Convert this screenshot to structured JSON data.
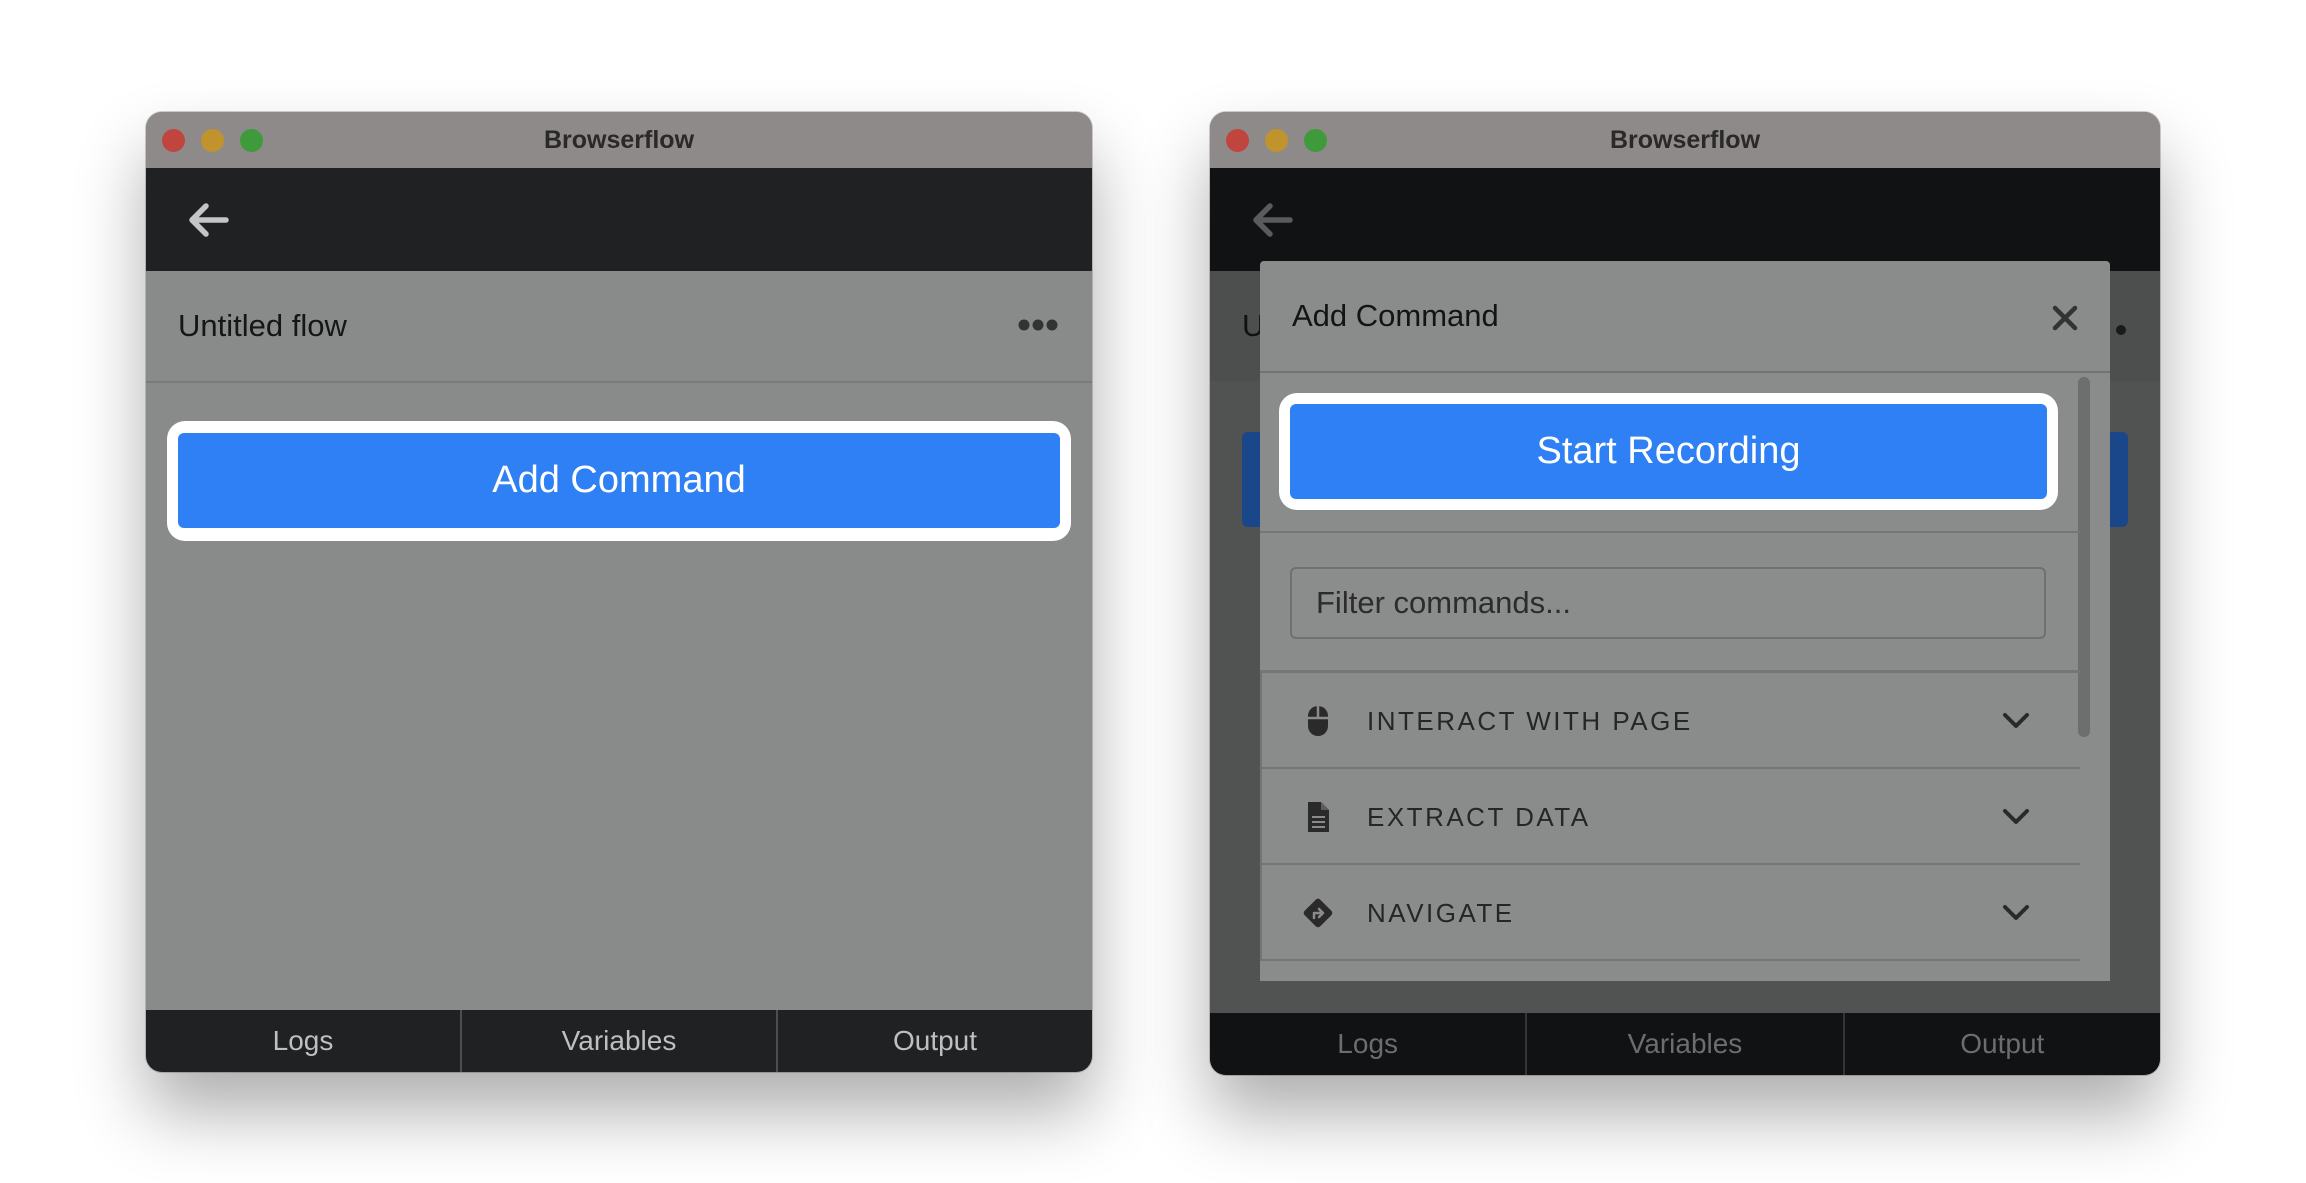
{
  "window_left": {
    "title": "Browserflow",
    "flow_title": "Untitled flow",
    "add_command_label": "Add Command",
    "tabs": [
      "Logs",
      "Variables",
      "Output"
    ]
  },
  "window_right": {
    "title": "Browserflow",
    "flow_title_partial": "U",
    "modal": {
      "title": "Add Command",
      "start_recording_label": "Start Recording",
      "filter_placeholder": "Filter commands...",
      "categories": [
        {
          "label": "INTERACT WITH PAGE",
          "icon": "mouse-icon"
        },
        {
          "label": "EXTRACT DATA",
          "icon": "document-icon"
        },
        {
          "label": "NAVIGATE",
          "icon": "directions-icon"
        }
      ]
    },
    "tabs": [
      "Logs",
      "Variables",
      "Output"
    ]
  },
  "colors": {
    "accent_blue": "#2f80f5",
    "navbar_dark": "#1f2123",
    "highlight": "#ffffff"
  }
}
